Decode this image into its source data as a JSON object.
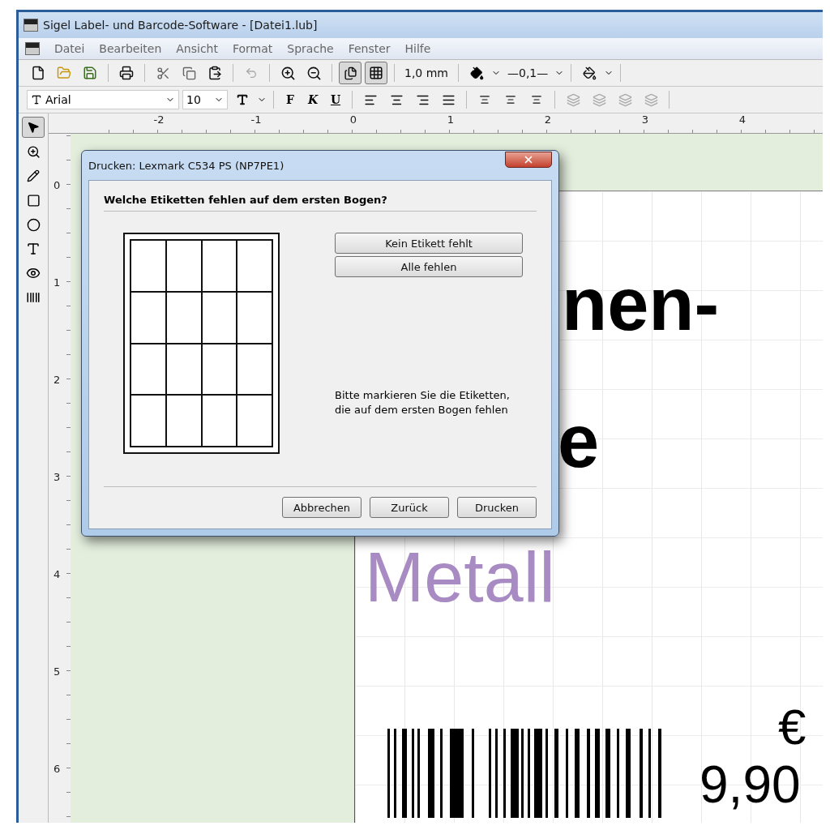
{
  "window": {
    "title": "Sigel Label- und Barcode-Software - [Datei1.lub]"
  },
  "menu": [
    "Datei",
    "Bearbeiten",
    "Ansicht",
    "Format",
    "Sprache",
    "Fenster",
    "Hilfe"
  ],
  "toolbar": {
    "label_view_on": true,
    "grid_on": true,
    "grid_spacing": "1,0 mm",
    "line_width": "—0,1—"
  },
  "format_bar": {
    "font": "Arial",
    "size": "10",
    "bold": "F",
    "italic": "K",
    "underline": "U"
  },
  "tools": [
    {
      "kind": "pointer",
      "selected": true
    },
    {
      "kind": "zoom",
      "selected": false
    },
    {
      "kind": "pencil",
      "selected": false
    },
    {
      "kind": "rectangle",
      "selected": false
    },
    {
      "kind": "ellipse",
      "selected": false
    },
    {
      "kind": "text",
      "selected": false
    },
    {
      "kind": "image",
      "selected": false
    },
    {
      "kind": "barcode",
      "selected": false
    }
  ],
  "ruler": {
    "horizontal": [
      "-2",
      "-1",
      "0",
      "1",
      "2",
      "3",
      "4"
    ],
    "vertical": [
      "0",
      "1",
      "2",
      "3",
      "4",
      "5",
      "6"
    ]
  },
  "label": {
    "texts": [
      {
        "text": "nen-",
        "color": "#000000"
      },
      {
        "text": "e",
        "color": "#000000"
      },
      {
        "text": "Metall",
        "color": "#a98bc3"
      },
      {
        "text": "€",
        "color": "#000000"
      },
      {
        "text": "9,90",
        "color": "#000000"
      }
    ]
  },
  "dialog": {
    "title": "Drucken: Lexmark C534 PS (NP7PE1)",
    "question": "Welche Etiketten fehlen auf dem ersten Bogen?",
    "sheet": [
      [
        {
          "missing": false
        },
        {
          "missing": false
        },
        {
          "missing": false
        },
        {
          "missing": false
        }
      ],
      [
        {
          "missing": false
        },
        {
          "missing": false
        },
        {
          "missing": false
        },
        {
          "missing": false
        }
      ],
      [
        {
          "missing": false
        },
        {
          "missing": false
        },
        {
          "missing": false
        },
        {
          "missing": false
        }
      ],
      [
        {
          "missing": false
        },
        {
          "missing": false
        },
        {
          "missing": false
        },
        {
          "missing": false
        }
      ]
    ],
    "side_buttons": [
      "Kein Etikett fehlt",
      "Alle fehlen"
    ],
    "instruction": "Bitte markieren Sie die Etiketten, die auf dem ersten Bogen fehlen",
    "buttons": [
      "Abbrechen",
      "Zurück",
      "Drucken"
    ]
  }
}
